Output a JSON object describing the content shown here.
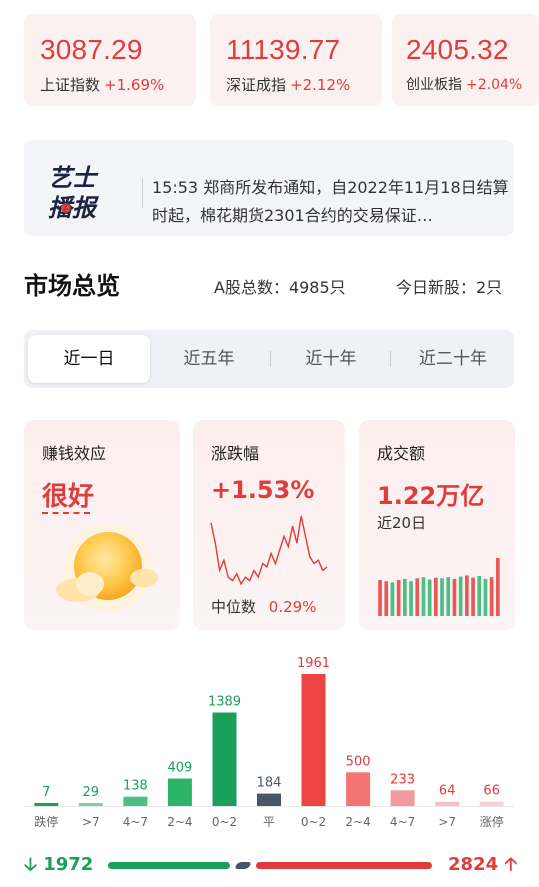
{
  "indices": [
    {
      "value": "3087.29",
      "name": "上证指数",
      "change": "+1.69%"
    },
    {
      "value": "11139.77",
      "name": "深证成指",
      "change": "+2.12%"
    },
    {
      "value": "2405.32",
      "name": "创业板指",
      "change": "+2.04%"
    }
  ],
  "news": {
    "logo_line1": "艺士",
    "logo_line2": "播报",
    "text": "15:53 郑商所发布通知，自2022年11月18日结算时起，棉花期货2301合约的交易保证…"
  },
  "overview": {
    "title": "市场总览",
    "a_share_total": "A股总数：4985只",
    "new_today": "今日新股：2只"
  },
  "tabs": [
    {
      "label": "近一日",
      "active": true
    },
    {
      "label": "近五年",
      "active": false
    },
    {
      "label": "近十年",
      "active": false
    },
    {
      "label": "近二十年",
      "active": false
    }
  ],
  "cards": {
    "sentiment": {
      "label": "赚钱效应",
      "value": "很好",
      "icon": "sun-icon"
    },
    "change": {
      "label": "涨跌幅",
      "value": "+1.53%",
      "median_label": "中位数",
      "median_value": "0.29%"
    },
    "turnover": {
      "label": "成交额",
      "value": "1.22万亿",
      "period": "近20日"
    }
  },
  "chart_data": [
    {
      "type": "line",
      "title": "涨跌幅",
      "series": [
        {
          "values": [
            0.9,
            0.6,
            0.2,
            0.35,
            0.1,
            0.05,
            0.15,
            0.0,
            0.1,
            0.05,
            0.2,
            0.1,
            0.3,
            0.25,
            0.45,
            0.3,
            0.5,
            0.7,
            0.55,
            0.85,
            0.6,
            1.0,
            0.7,
            0.4,
            0.3,
            0.35,
            0.2,
            0.25
          ]
        }
      ]
    },
    {
      "type": "bar",
      "title": "成交额",
      "values": [
        0.62,
        0.6,
        0.58,
        0.62,
        0.64,
        0.6,
        0.65,
        0.67,
        0.63,
        0.66,
        0.65,
        0.67,
        0.64,
        0.68,
        0.7,
        0.66,
        0.69,
        0.64,
        0.67,
        1.0
      ],
      "colors": [
        "#e85a5a",
        "#e85a5a",
        "#4cbf85",
        "#e85a5a",
        "#4cbf85",
        "#4cbf85",
        "#e85a5a",
        "#4cbf85",
        "#4cbf85",
        "#e85a5a",
        "#4cbf85",
        "#4cbf85",
        "#e85a5a",
        "#4cbf85",
        "#e85a5a",
        "#e85a5a",
        "#4cbf85",
        "#4cbf85",
        "#e85a5a",
        "#e85a5a"
      ]
    },
    {
      "type": "bar",
      "title": "",
      "categories": [
        "跌停",
        ">7",
        "4~7",
        "2~4",
        "0~2",
        "平",
        "0~2",
        "2~4",
        "4~7",
        ">7",
        "涨停"
      ],
      "values": [
        7,
        29,
        138,
        409,
        1389,
        184,
        1961,
        500,
        233,
        64,
        66
      ],
      "colors": [
        "#1aa05a",
        "#7fd1a3",
        "#4cbf85",
        "#2db36a",
        "#1aa05a",
        "#4a5568",
        "#ef4444",
        "#f47474",
        "#f59a9a",
        "#f8c0c0",
        "#f9d3d3"
      ],
      "label_colors": [
        "#1aa05a",
        "#1aa05a",
        "#1aa05a",
        "#1aa05a",
        "#1aa05a",
        "#4a5568",
        "#e03c3c",
        "#e03c3c",
        "#e03c3c",
        "#e03c3c",
        "#e03c3c"
      ]
    }
  ],
  "summary": {
    "down": "1972",
    "up": "2824",
    "down_icon": "arrow-down-icon",
    "up_icon": "arrow-up-icon"
  }
}
